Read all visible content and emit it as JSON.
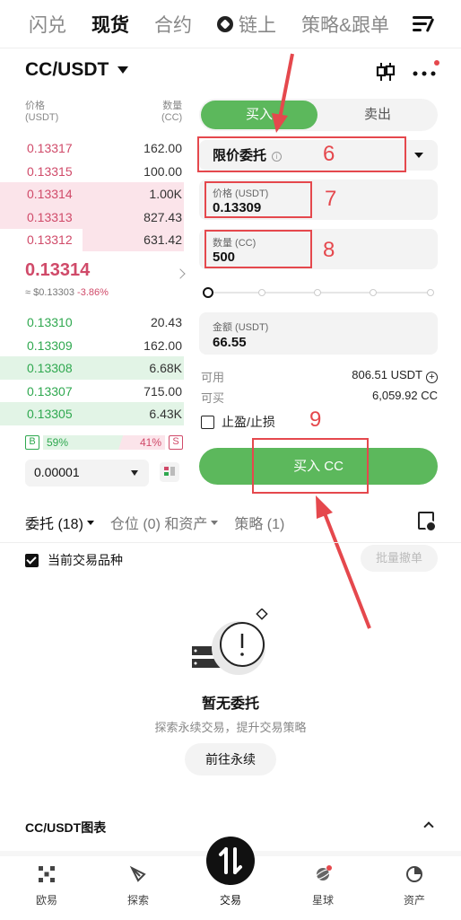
{
  "top_tabs": [
    "闪兑",
    "现货",
    "合约",
    "链上",
    "策略&跟单"
  ],
  "pair": "CC/USDT",
  "orderbook": {
    "price_header": "价格\n(USDT)",
    "qty_header": "数量\n(CC)",
    "asks": [
      {
        "price": "0.13317",
        "qty": "162.00",
        "depth": 0.0
      },
      {
        "price": "0.13315",
        "qty": "100.00",
        "depth": 0.0
      },
      {
        "price": "0.13314",
        "qty": "1.00K",
        "depth": 1.0
      },
      {
        "price": "0.13313",
        "qty": "827.43",
        "depth": 1.0
      },
      {
        "price": "0.13312",
        "qty": "631.42",
        "depth": 0.55
      }
    ],
    "last_price": "0.13314",
    "last_usd": "≈ $0.13303",
    "last_change": "-3.86%",
    "bids": [
      {
        "price": "0.13310",
        "qty": "20.43",
        "depth": 0.0
      },
      {
        "price": "0.13309",
        "qty": "162.00",
        "depth": 0.0
      },
      {
        "price": "0.13308",
        "qty": "6.68K",
        "depth": 1.0
      },
      {
        "price": "0.13307",
        "qty": "715.00",
        "depth": 0.0
      },
      {
        "price": "0.13305",
        "qty": "6.43K",
        "depth": 1.0
      }
    ],
    "buy_pct": "59%",
    "sell_pct": "41%",
    "b_tag": "B",
    "s_tag": "S",
    "step": "0.00001"
  },
  "trade": {
    "buy_tab": "买入",
    "sell_tab": "卖出",
    "order_type": "限价委托",
    "price_label": "价格 (USDT)",
    "price_value": "0.13309",
    "qty_label": "数量 (CC)",
    "qty_value": "500",
    "amount_label": "金额 (USDT)",
    "amount_value": "66.55",
    "available_label": "可用",
    "available_value": "806.51 USDT",
    "can_buy_label": "可买",
    "can_buy_value": "6,059.92 CC",
    "tpsl_label": "止盈/止损",
    "buy_button": "买入 CC",
    "slider_value": 0
  },
  "annotations": {
    "n6": "6",
    "n7": "7",
    "n8": "8",
    "n9": "9"
  },
  "orders_tabs": {
    "orders": "委托 (18)",
    "positions": "仓位 (0) 和资产",
    "strategy": "策略 (1)"
  },
  "current_pair_label": "当前交易品种",
  "batch_cancel": "批量撤单",
  "empty": {
    "title": "暂无委托",
    "subtitle": "探索永续交易，提升交易策略",
    "button": "前往永续"
  },
  "chart_section": "CC/USDT图表",
  "bottom_nav": [
    "欧易",
    "探索",
    "交易",
    "星球",
    "资产"
  ],
  "colors": {
    "buy": "#5cb85c",
    "sell": "#d04a69",
    "annotation": "#e5484d"
  }
}
